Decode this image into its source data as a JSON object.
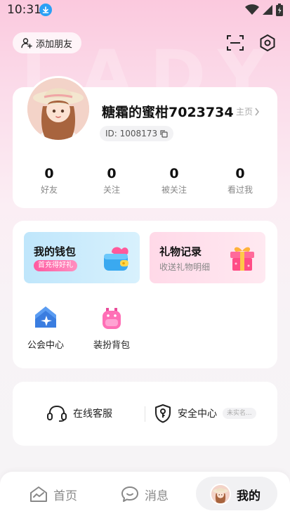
{
  "status_bar": {
    "time": "10:31"
  },
  "watermark": "LADY",
  "top": {
    "add_friend_label": "添加朋友"
  },
  "profile": {
    "nickname": "糖霜的蜜柑7023734",
    "home_link": "主页",
    "id_text": "ID: 1008173",
    "stats": [
      {
        "value": "0",
        "label": "好友"
      },
      {
        "value": "0",
        "label": "关注"
      },
      {
        "value": "0",
        "label": "被关注"
      },
      {
        "value": "0",
        "label": "看过我"
      }
    ]
  },
  "services": {
    "wallet": {
      "title": "我的钱包",
      "badge": "首充得好礼"
    },
    "gifts": {
      "title": "礼物记录",
      "subtitle": "收送礼物明细"
    },
    "items": [
      {
        "label": "公会中心",
        "icon": "guild-icon"
      },
      {
        "label": "装扮背包",
        "icon": "backpack-icon"
      }
    ]
  },
  "support": {
    "customer_service": "在线客服",
    "security_center": "安全中心",
    "security_badge": "未实名..."
  },
  "nav": {
    "tabs": [
      {
        "label": "首页",
        "icon": "home-icon"
      },
      {
        "label": "消息",
        "icon": "message-icon"
      },
      {
        "label": "我的",
        "icon": "avatar",
        "active": true
      }
    ]
  },
  "colors": {
    "accent_pink": "#ff5aa0",
    "wallet_bg": "#bfe6fb",
    "gift_bg": "#ffd9e8"
  }
}
